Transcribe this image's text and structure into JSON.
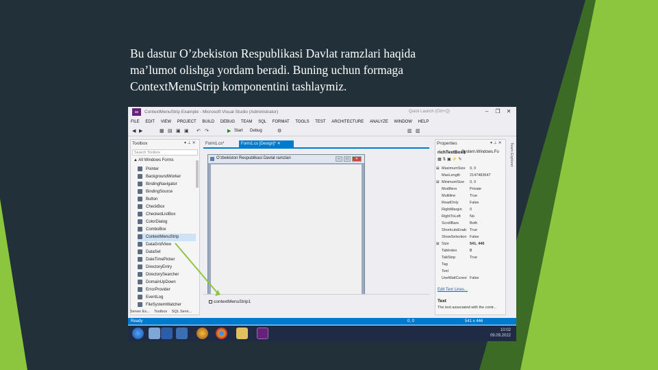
{
  "slide": {
    "heading_lines": [
      "Bu dastur O’zbekiston Respublikasi Davlat ramzlari haqida",
      "ma’lumot olishga yordam beradi. Buning uchun formaga",
      "ContextMenuStrip komponentini tashlaymiz."
    ],
    "colors": {
      "background": "#223139",
      "accent_green": "#8cc63f",
      "dark_green": "#3c6b26",
      "vs_blue": "#007acc"
    }
  },
  "window": {
    "title": "ContextMenuStrip Example - Microsoft Visual Studio (Administrator)",
    "quick_launch": "Quick Launch (Ctrl+Q)",
    "menu": [
      "FILE",
      "EDIT",
      "VIEW",
      "PROJECT",
      "BUILD",
      "DEBUG",
      "TEAM",
      "SQL",
      "FORMAT",
      "TOOLS",
      "TEST",
      "ARCHITECTURE",
      "ANALYZE",
      "WINDOW",
      "HELP"
    ],
    "toolbar": {
      "start_label": "Start",
      "config_label": "Debug"
    }
  },
  "toolbox": {
    "title": "Toolbox",
    "search_placeholder": "Search Toolbox",
    "group": "▲ All Windows Forms",
    "items": [
      "Pointer",
      "BackgroundWorker",
      "BindingNavigator",
      "BindingSource",
      "Button",
      "CheckBox",
      "CheckedListBox",
      "ColorDialog",
      "ComboBox",
      "ContextMenuStrip",
      "DataGridView",
      "DataSet",
      "DateTimePicker",
      "DirectoryEntry",
      "DirectorySearcher",
      "DomainUpDown",
      "ErrorProvider",
      "EventLog",
      "FileSystemWatcher"
    ],
    "selected_item": "ContextMenuStrip",
    "bottom_tabs": [
      "Server Ex...",
      "Toolbox",
      "SQL Servi..."
    ]
  },
  "documents": {
    "tabs": [
      "Form1.cs*",
      "Form1.cs [Design]*"
    ],
    "form_title": "O’zbekiston Respublikasi Davlat ramzlari",
    "tray_component": "contextMenuStrip1"
  },
  "properties": {
    "title": "Properties",
    "object_name": "richTextBox1",
    "object_type": "System.Windows.Fo",
    "rows": [
      {
        "k": "MaximumSize",
        "v": "0, 0",
        "group": true
      },
      {
        "k": "MaxLength",
        "v": "2147483647"
      },
      {
        "k": "MinimumSize",
        "v": "0, 0",
        "group": true
      },
      {
        "k": "Modifiers",
        "v": "Private"
      },
      {
        "k": "Multiline",
        "v": "True"
      },
      {
        "k": "ReadOnly",
        "v": "False"
      },
      {
        "k": "RightMargin",
        "v": "0"
      },
      {
        "k": "RightToLeft",
        "v": "No"
      },
      {
        "k": "ScrollBars",
        "v": "Both"
      },
      {
        "k": "ShortcutsEnab",
        "v": "True"
      },
      {
        "k": "ShowSelection",
        "v": "False"
      },
      {
        "k": "Size",
        "v": "541, 446",
        "group": true,
        "bold": true
      },
      {
        "k": "TabIndex",
        "v": "0",
        "bold": true
      },
      {
        "k": "TabStop",
        "v": "True"
      },
      {
        "k": "Tag",
        "v": ""
      },
      {
        "k": "Text",
        "v": ""
      },
      {
        "k": "UseWaitCursor",
        "v": "False"
      }
    ],
    "link": "Edit Text Lines...",
    "desc_title": "Text",
    "desc_text": "The text associated with the contr...",
    "side_tab": "Team Explorer"
  },
  "status": {
    "ready": "Ready",
    "position": "0, 0",
    "size": "541 x 446"
  },
  "taskbar": {
    "time": "10:02",
    "date": "09.09.2022"
  }
}
